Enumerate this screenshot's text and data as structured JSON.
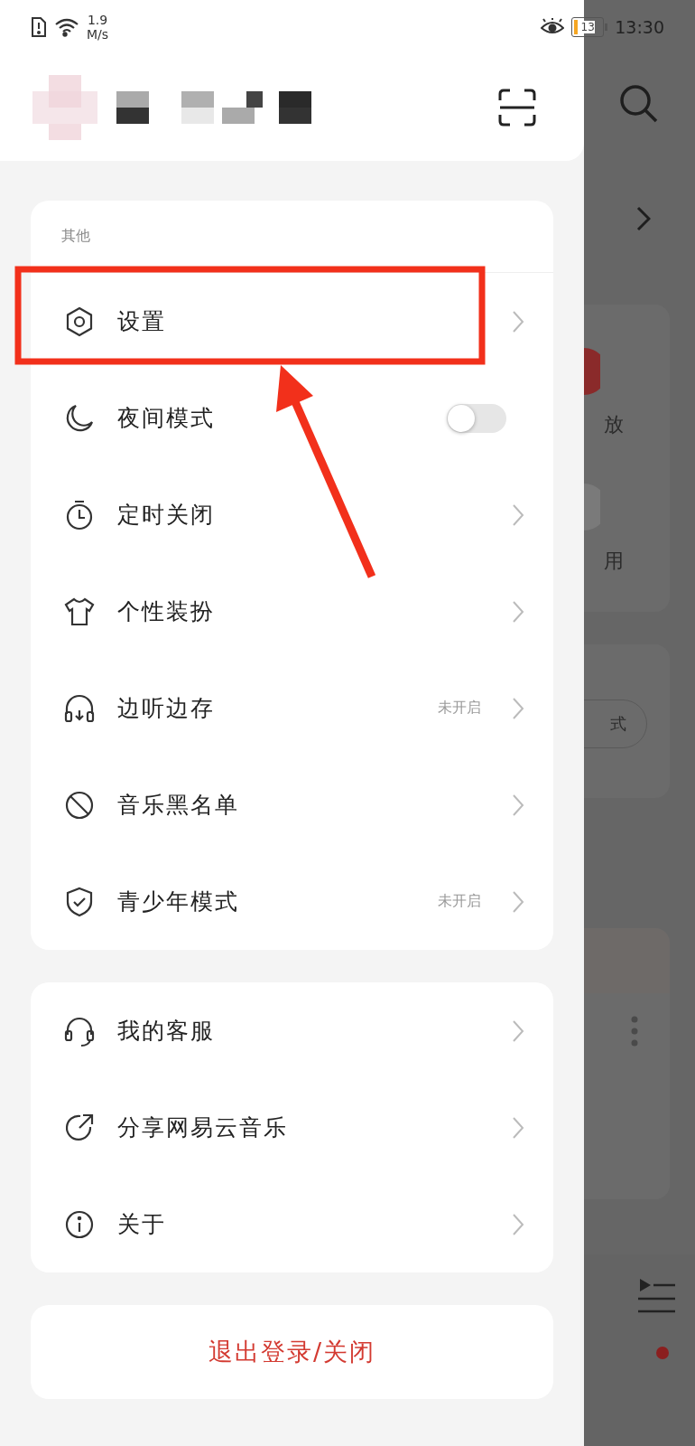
{
  "status_bar": {
    "speed": "1.9",
    "speed_unit": "M/s",
    "battery": "13",
    "time": "13:30"
  },
  "drawer": {
    "section_title": "其他",
    "items": [
      {
        "label": "设置",
        "kind": "link"
      },
      {
        "label": "夜间模式",
        "kind": "toggle",
        "on": false
      },
      {
        "label": "定时关闭",
        "kind": "link"
      },
      {
        "label": "个性装扮",
        "kind": "link"
      },
      {
        "label": "边听边存",
        "kind": "link",
        "status": "未开启"
      },
      {
        "label": "音乐黑名单",
        "kind": "link"
      },
      {
        "label": "青少年模式",
        "kind": "link",
        "status": "未开启"
      }
    ],
    "more_items": [
      {
        "label": "我的客服",
        "kind": "link"
      },
      {
        "label": "分享网易云音乐",
        "kind": "link"
      },
      {
        "label": "关于",
        "kind": "link"
      }
    ],
    "logout": "退出登录/关闭"
  },
  "background": {
    "texts": [
      "放",
      "用",
      "式"
    ]
  }
}
